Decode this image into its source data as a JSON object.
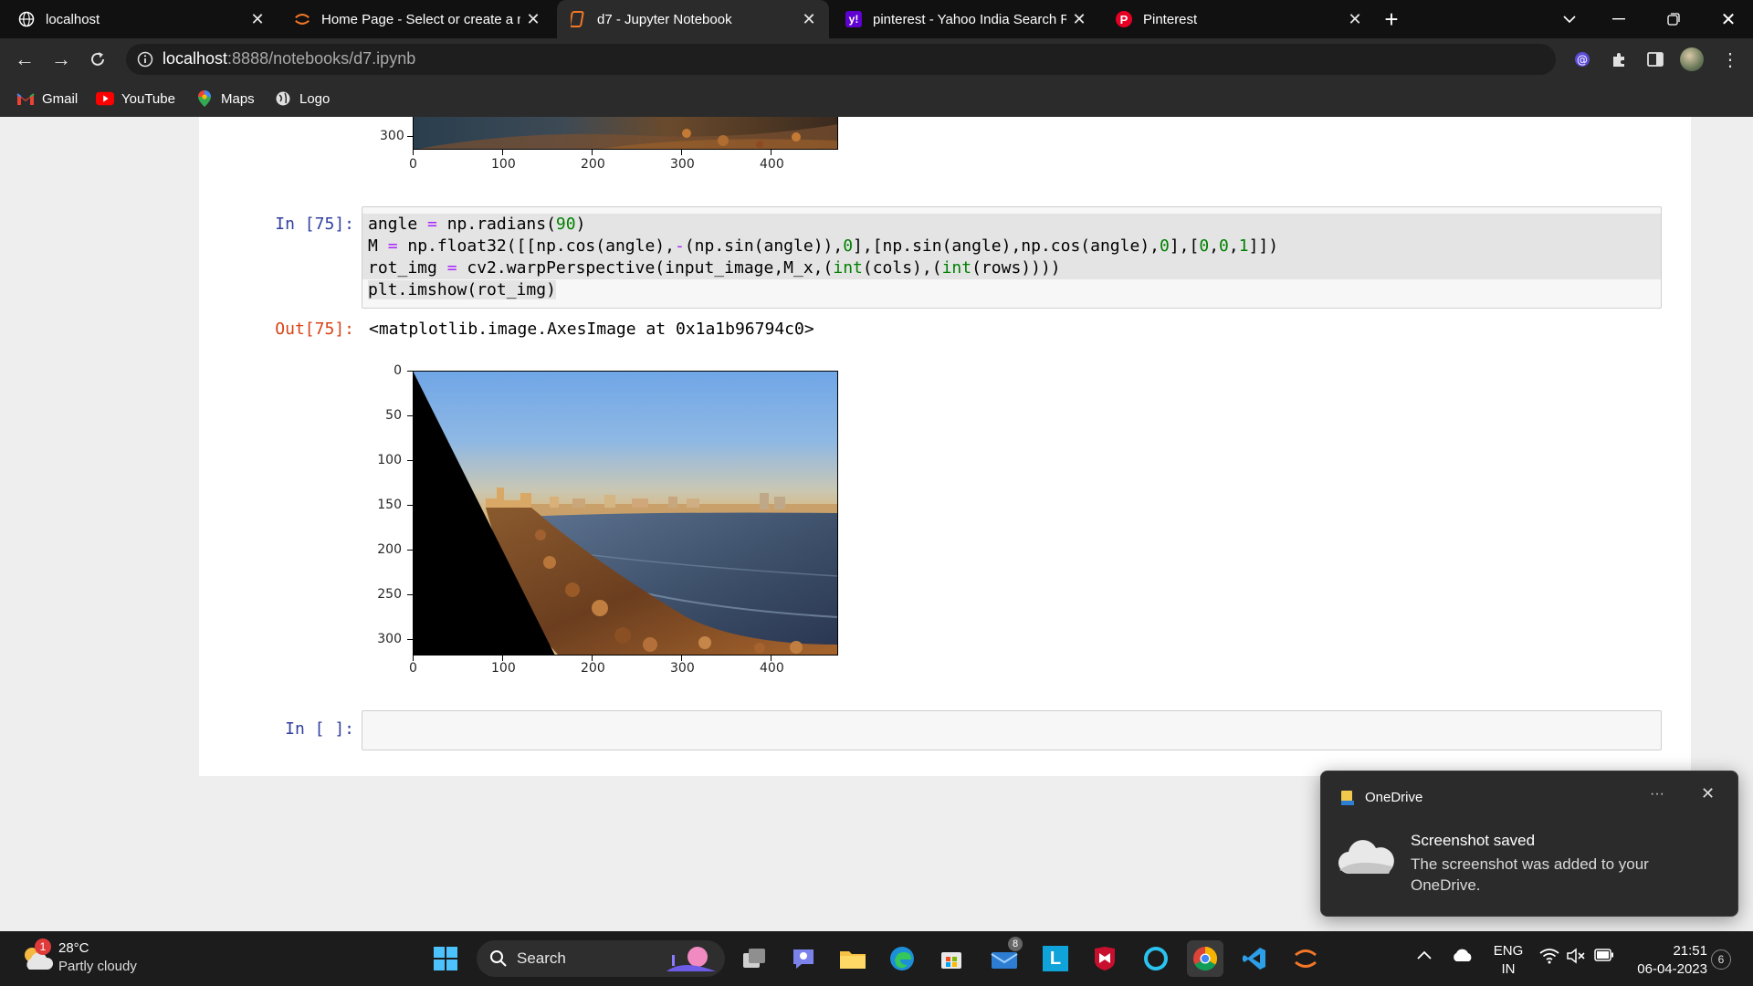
{
  "browser": {
    "tabs": [
      {
        "title": "localhost",
        "icon": "globe-icon"
      },
      {
        "title": "Home Page - Select or create a n",
        "icon": "jupyter-icon"
      },
      {
        "title": "d7 - Jupyter Notebook",
        "icon": "notebook-icon"
      },
      {
        "title": "pinterest - Yahoo India Search Re",
        "icon": "yahoo-icon"
      },
      {
        "title": "Pinterest",
        "icon": "pinterest-icon"
      }
    ],
    "url_host": "localhost",
    "url_path": ":8888/notebooks/d7.ipynb",
    "bookmarks": [
      {
        "label": "Gmail",
        "icon": "gmail-icon"
      },
      {
        "label": "YouTube",
        "icon": "youtube-icon"
      },
      {
        "label": "Maps",
        "icon": "maps-icon"
      },
      {
        "label": "Logo",
        "icon": "globe-icon"
      }
    ]
  },
  "notebook": {
    "prev_output": {
      "y_ticks": [
        "300"
      ],
      "x_ticks": [
        "0",
        "100",
        "200",
        "300",
        "400"
      ]
    },
    "cell": {
      "in_prompt": "In [75]:",
      "out_prompt": "Out[75]:",
      "output_text": "<matplotlib.image.AxesImage at 0x1a1b96794c0>",
      "y_ticks": [
        "0",
        "50",
        "100",
        "150",
        "200",
        "250",
        "300"
      ],
      "x_ticks": [
        "0",
        "100",
        "200",
        "300",
        "400"
      ]
    },
    "empty_cell": {
      "in_prompt": "In [ ]:"
    }
  },
  "toast": {
    "app": "OneDrive",
    "title": "Screenshot saved",
    "body": "The screenshot was added to your OneDrive.",
    "more": "···"
  },
  "taskbar": {
    "weather_temp": "28°C",
    "weather_desc": "Partly cloudy",
    "weather_badge": "1",
    "search_label": "Search",
    "lang_top": "ENG",
    "lang_bottom": "IN",
    "time": "21:51",
    "date": "06-04-2023",
    "notif_count": "6",
    "mail_badge": "8"
  }
}
